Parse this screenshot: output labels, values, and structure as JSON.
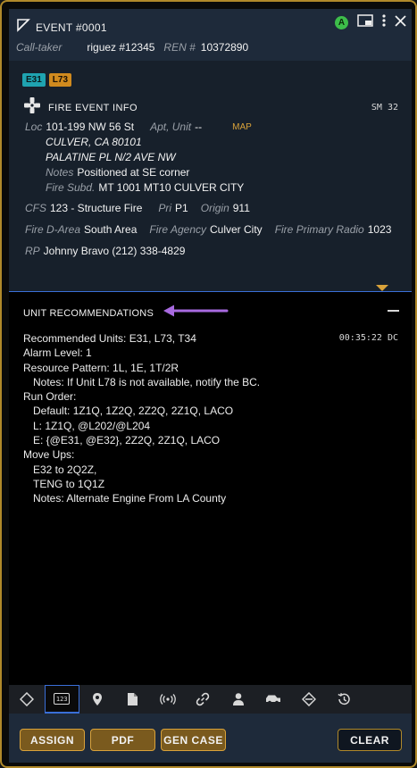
{
  "header": {
    "title": "EVENT #0001",
    "calltaker_label": "Call-taker",
    "calltaker_value": "riguez #12345",
    "ren_label": "REN #",
    "ren_value": "10372890",
    "status_avatar": "A"
  },
  "info": {
    "badges": [
      "E31",
      "L73"
    ],
    "section_title": "FIRE EVENT INFO",
    "sm": "SM 32",
    "loc_label": "Loc",
    "loc_value": "101-199 NW 56 St",
    "apt_label": "Apt, Unit",
    "apt_value": "--",
    "map_link": "MAP",
    "city_line": "CULVER, CA 80101",
    "cross_street": "PALATINE PL N/2 AVE NW",
    "notes_label": "Notes",
    "notes_value": "Positioned at SE corner",
    "subd_label": "Fire Subd.",
    "subd_value": "MT 1001 MT10 CULVER CITY",
    "cfs_label": "CFS",
    "cfs_value": "123 - Structure Fire",
    "pri_label": "Pri",
    "pri_value": "P1",
    "origin_label": "Origin",
    "origin_value": "911",
    "darea_label": "Fire D-Area",
    "darea_value": "South Area",
    "agency_label": "Fire Agency",
    "agency_value": "Culver City",
    "radio_label": "Fire Primary Radio",
    "radio_value": "1023",
    "rp_label": "RP",
    "rp_value": "Johnny Bravo (212) 338-4829"
  },
  "recommendations": {
    "title": "UNIT RECOMMENDATIONS",
    "time": "00:35:22 DC",
    "lines": [
      "Recommended Units: E31, L73, T34",
      "Alarm Level: 1",
      "Resource Pattern: 1L, 1E, 1T/2R",
      "Notes: If Unit L78 is not available, notify the BC.",
      "Run Order:",
      "Default: 1Z1Q, 1Z2Q, 2Z2Q, 2Z1Q, LACO",
      "L: 1Z1Q, @L202/@L204",
      "E: {@E31, @E32}, 2Z2Q, 2Z1Q, LACO",
      "Move Ups:",
      "E32 to 2Q2Z,",
      "TENG to 1Q1Z",
      "Notes: Alternate Engine From LA County"
    ]
  },
  "toolbar": {
    "items": [
      "diamond-icon",
      "keypad-123-icon",
      "location-pin-icon",
      "document-icon",
      "radio-signal-icon",
      "link-icon",
      "person-icon",
      "vehicle-icon",
      "hazard-diamond-icon",
      "history-icon"
    ],
    "active_index": 1,
    "keypad_label": "123"
  },
  "footer": {
    "assign_label": "ASSIGN",
    "pdf_label": "PDF",
    "gen_case_label": "GEN CASE",
    "clear_label": "CLEAR"
  },
  "colors": {
    "accent_gold": "#d9a23a",
    "header_bg": "#1e2a3a",
    "active_blue": "#3a6fd8",
    "arrow_purple": "#a86ae0",
    "status_green": "#3dbd4a"
  }
}
